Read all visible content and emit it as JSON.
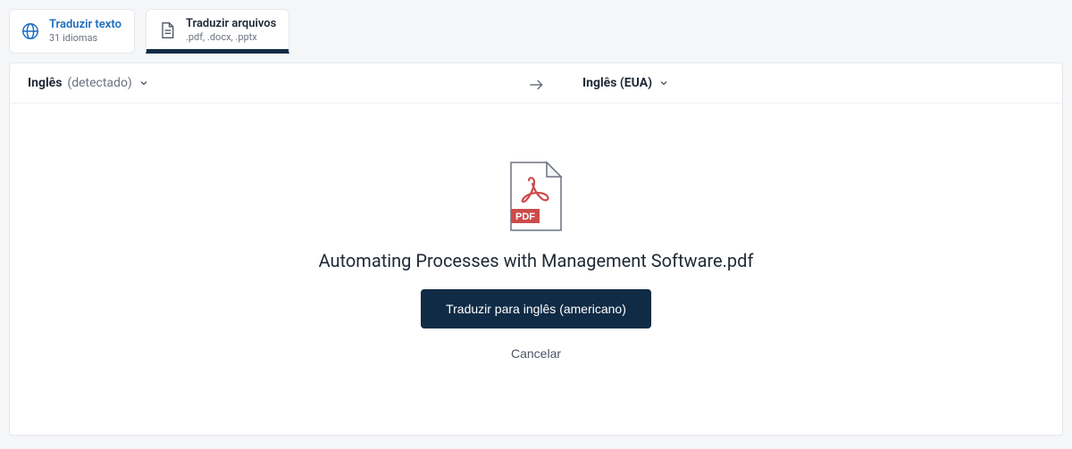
{
  "tabs": {
    "text": {
      "title": "Traduzir texto",
      "subtitle": "31 idiomas"
    },
    "files": {
      "title": "Traduzir arquivos",
      "subtitle": ".pdf, .docx, .pptx"
    }
  },
  "langbar": {
    "source_lang": "Inglês",
    "source_detected": "(detectado)",
    "target_lang": "Inglês (EUA)"
  },
  "file": {
    "name": "Automating Processes with Management Software.pdf",
    "badge": "PDF"
  },
  "actions": {
    "translate": "Traduzir para inglês (americano)",
    "cancel": "Cancelar"
  }
}
